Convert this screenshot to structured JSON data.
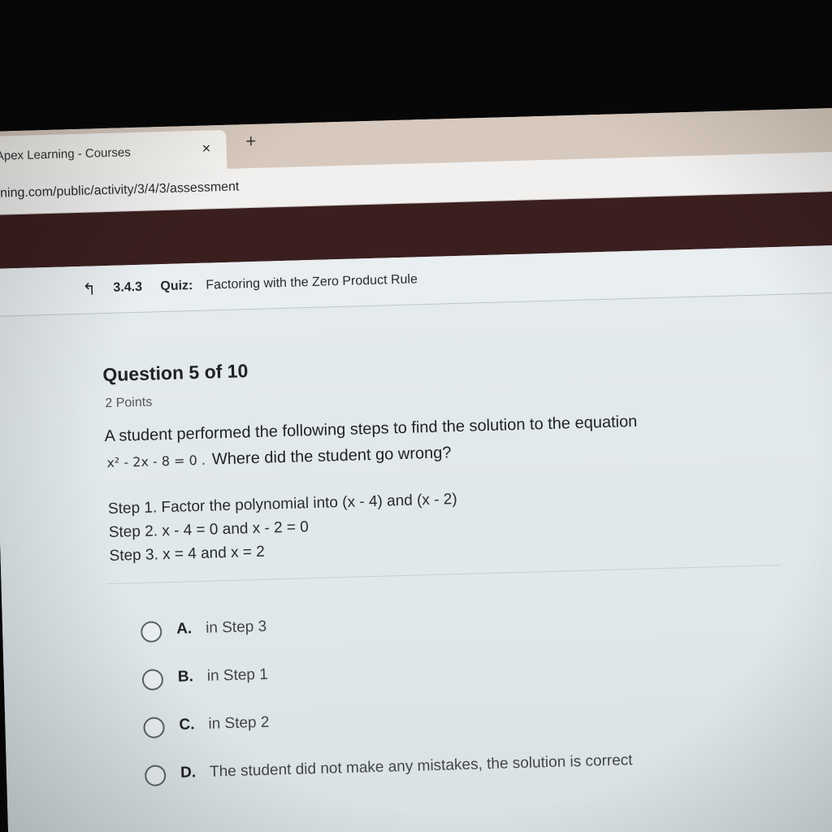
{
  "browser": {
    "tab_title": "Apex Learning - Courses",
    "tab_close": "×",
    "new_tab": "+",
    "url": "ning.com/public/activity/3/4/3/assessment"
  },
  "quiz": {
    "back_icon": "↰",
    "number": "3.4.3",
    "kind": "Quiz:",
    "title": "Factoring with the Zero Product Rule"
  },
  "question": {
    "heading": "Question 5 of 10",
    "points": "2 Points",
    "prompt_line1": "A student performed the following steps to find the solution to the equation",
    "equation": "x² - 2x - 8 = 0 .",
    "prompt_line2": "Where did the student go wrong?",
    "steps": [
      "Step 1. Factor the polynomial into (x - 4) and (x - 2)",
      "Step 2. x - 4 = 0 and x - 2 = 0",
      "Step 3. x = 4 and x = 2"
    ]
  },
  "options": [
    {
      "letter": "A.",
      "text": "in Step 3"
    },
    {
      "letter": "B.",
      "text": "in Step 1"
    },
    {
      "letter": "C.",
      "text": "in Step 2"
    },
    {
      "letter": "D.",
      "text": "The student did not make any mistakes, the solution is correct"
    }
  ],
  "colors": {
    "app_header": "#3b1f1f",
    "content_bg": "#e4eaed"
  }
}
